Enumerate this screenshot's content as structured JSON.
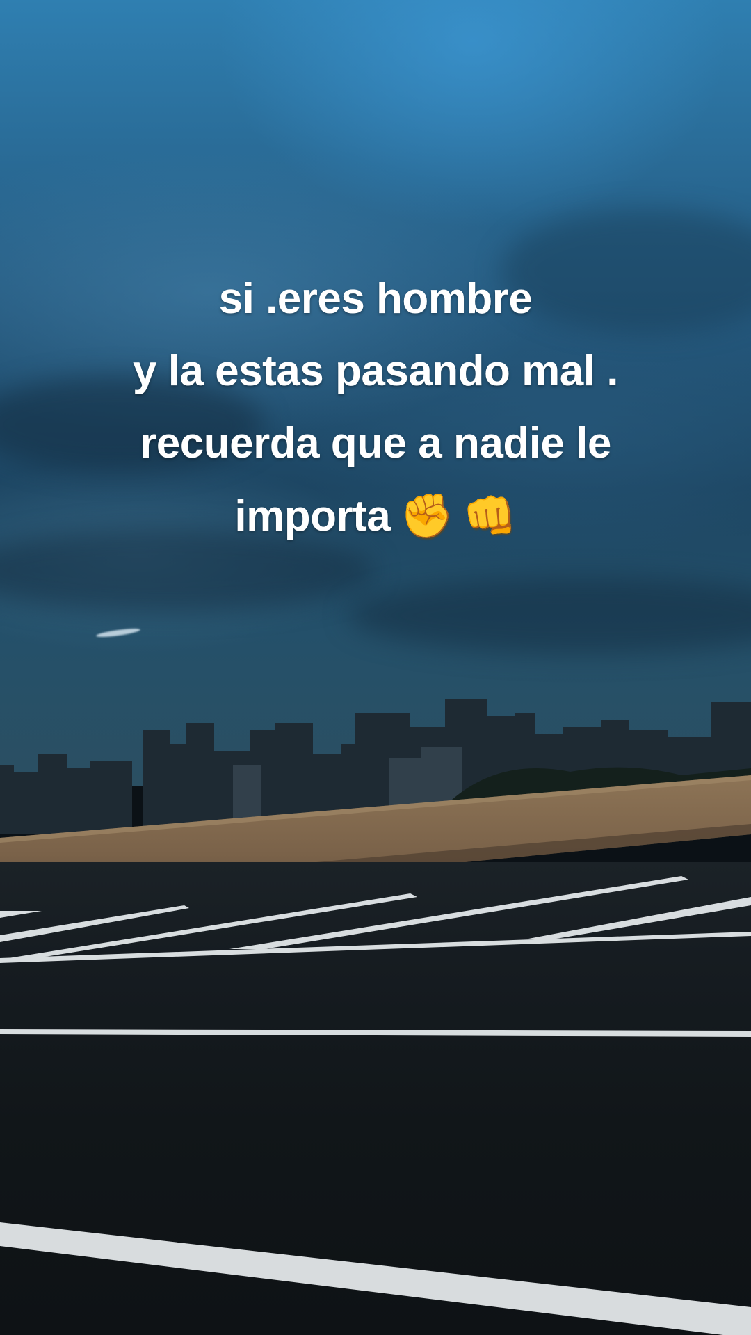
{
  "overlay_text": {
    "line1": "si .eres hombre",
    "line2": "y la estas pasando mal .",
    "line3": "recuerda que a nadie le",
    "line4": "importa",
    "emoji1": "✊",
    "emoji2": "👊"
  },
  "colors": {
    "caption_text": "#ffffff",
    "sky_top": "#2f7fb1",
    "sky_bottom": "#2b4f62",
    "road": "#14191d",
    "wall": "#8a7255",
    "lane_marking": "#e9eef0"
  }
}
